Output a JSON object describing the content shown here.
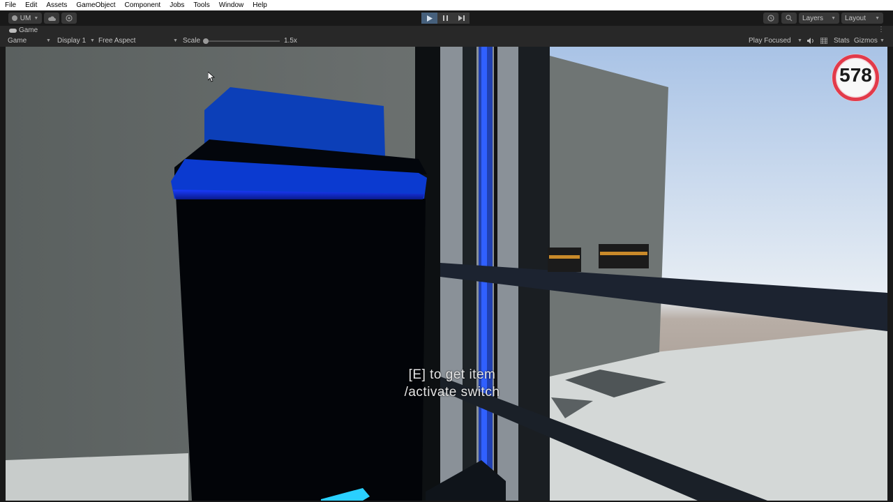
{
  "menu": [
    "File",
    "Edit",
    "Assets",
    "GameObject",
    "Component",
    "Jobs",
    "Tools",
    "Window",
    "Help"
  ],
  "toolbar": {
    "account": "UM",
    "layers": "Layers",
    "layout": "Layout"
  },
  "tab": {
    "label": "Game"
  },
  "controls": {
    "mode": "Game",
    "display": "Display 1",
    "aspect": "Free Aspect",
    "scale_label": "Scale",
    "scale_value": "1.5x",
    "play_focused": "Play Focused",
    "stats": "Stats",
    "gizmos": "Gizmos"
  },
  "hud": {
    "counter": "578",
    "hint_line1": "[E] to get item",
    "hint_line2": "/activate switch"
  }
}
